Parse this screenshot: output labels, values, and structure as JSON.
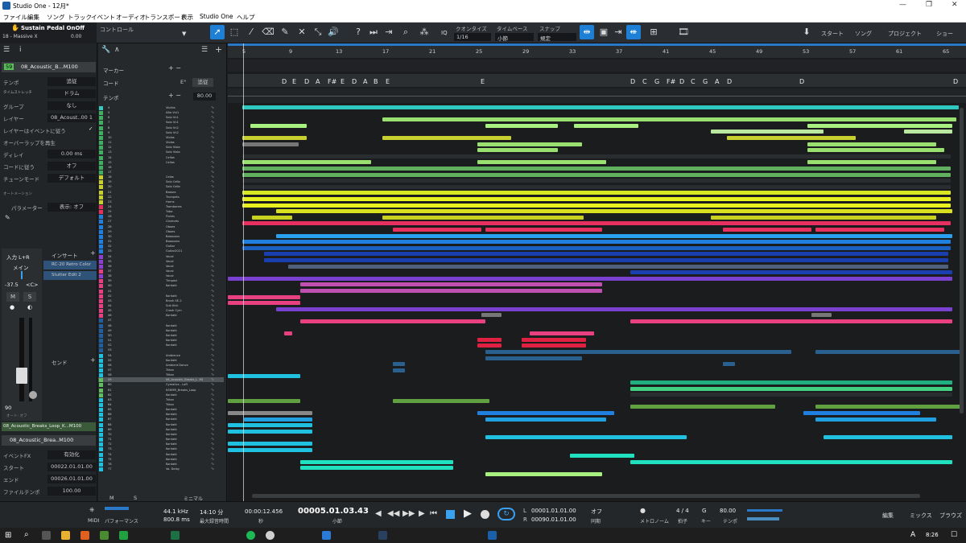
{
  "window": {
    "title": "Studio One - 12月*"
  },
  "menu": [
    "ファイル",
    "編集",
    "ソング",
    "トラック",
    "イベント",
    "オーディオ",
    "トランスポート",
    "表示",
    "Studio One",
    "ヘルプ"
  ],
  "toolbar": {
    "preset_name": "Sustain Pedal OnOff",
    "preset_sub": "18 - Massive X",
    "preset_value": "0.00",
    "control_label": "コントロール",
    "quantize_label": "クオンタイズ",
    "quantize_value": "1/16",
    "timebase_label": "タイムベース",
    "timebase_value": "小節",
    "snap_label": "スナップ",
    "snap_value": "規定",
    "iq": "IQ",
    "start": "スタート",
    "song": "ソング",
    "project": "プロジェクト",
    "show": "ショー"
  },
  "inspector": {
    "track_num": "59",
    "track_name": "08_Acoustic_B...M100",
    "rows": [
      {
        "k": "テンポ",
        "v": "追従"
      },
      {
        "k": "タイムストレッチ",
        "v": "ドラム"
      },
      {
        "k": "グループ",
        "v": "なし"
      },
      {
        "k": "レイヤー",
        "v": "08_Acoust..00 1"
      },
      {
        "k": "レイヤーはイベントに従う",
        "v": "✓"
      },
      {
        "k": "オーバーラップを再生",
        "v": ""
      },
      {
        "k": "ディレイ",
        "v": "0.00 ms"
      },
      {
        "k": "コードに従う",
        "v": "オフ"
      },
      {
        "k": "チューンモード",
        "v": "デフォルト"
      }
    ],
    "automation_label": "オートメーション",
    "param_label": "パラメーター",
    "param_value": "表示: オフ",
    "channel": {
      "input": "入力 L+R",
      "main": "メイン",
      "vol": "-37.5",
      "pan": "<C>",
      "m": "M",
      "s": "S",
      "fader_val": "90",
      "auto": "オート: オフ"
    },
    "inserts_label": "インサート",
    "insert1": "RC-20 Retro Color",
    "insert2": "Stutter Edit 2",
    "sends_label": "センド",
    "clip_name": "08_Acoustic_Breaks_Loop_K...M100",
    "event_name": "08_Acoustic_Brea..M100",
    "event_fx_label": "イベントFX",
    "event_fx_value": "有効化",
    "start_label": "スタート",
    "start_value": "00022.01.01.00",
    "end_label": "エンド",
    "end_value": "00026.01.01.00",
    "file_tempo_label": "ファイルテンポ",
    "file_tempo_value": "100.00"
  },
  "lanes": {
    "marker": "マーカー",
    "chord": "コード",
    "tempo": "テンポ",
    "key": "E°",
    "follow": "追従",
    "tempo_value": "80.00"
  },
  "ruler": [
    "5",
    "9",
    "13",
    "17",
    "21",
    "25",
    "29",
    "33",
    "37",
    "41",
    "45",
    "49",
    "53",
    "57",
    "61",
    "65"
  ],
  "chords": [
    "D",
    "E",
    "D",
    "A",
    "F#",
    "E",
    "D",
    "A",
    "B",
    "E",
    "E",
    "D",
    "C",
    "G",
    "F#",
    "D",
    "C",
    "G",
    "A",
    "D",
    "D",
    "D"
  ],
  "tracks": [
    {
      "n": "4",
      "name": "Violins",
      "c": "#37c8c0"
    },
    {
      "n": "5",
      "name": "Alto Vni1",
      "c": "#40b060"
    },
    {
      "n": "6",
      "name": "Solo Vn1",
      "c": "#40b060"
    },
    {
      "n": "7",
      "name": "Solo Vn1",
      "c": "#40b060"
    },
    {
      "n": "8",
      "name": "Solo Vn2",
      "c": "#40b060"
    },
    {
      "n": "9",
      "name": "Solo Vn2",
      "c": "#40b060"
    },
    {
      "n": "10",
      "name": "Violas",
      "c": "#40b060"
    },
    {
      "n": "11",
      "name": "Violas",
      "c": "#40b060"
    },
    {
      "n": "12",
      "name": "Solo Viola",
      "c": "#40b060"
    },
    {
      "n": "13",
      "name": "Solo Viola",
      "c": "#40b060"
    },
    {
      "n": "14",
      "name": "Cellos",
      "c": "#40b060"
    },
    {
      "n": "15",
      "name": "Cellos",
      "c": "#40b060"
    },
    {
      "n": "16",
      "name": "",
      "c": "#40b060"
    },
    {
      "n": "17",
      "name": "",
      "c": "#40b060"
    },
    {
      "n": "18",
      "name": "Celos",
      "c": "#c8d030"
    },
    {
      "n": "19",
      "name": "Solo Cello",
      "c": "#c8d030"
    },
    {
      "n": "20",
      "name": "Solo Cello",
      "c": "#c8d030"
    },
    {
      "n": "21",
      "name": "Basses",
      "c": "#c8d030"
    },
    {
      "n": "22",
      "name": "Trumpets",
      "c": "#c8d030"
    },
    {
      "n": "23",
      "name": "Horns",
      "c": "#c8d030"
    },
    {
      "n": "24",
      "name": "Trombones",
      "c": "#e83060"
    },
    {
      "n": "25",
      "name": "Tuba",
      "c": "#e83060"
    },
    {
      "n": "26",
      "name": "Flutes",
      "c": "#2080e0"
    },
    {
      "n": "27",
      "name": "Clarinets",
      "c": "#2080e0"
    },
    {
      "n": "28",
      "name": "Oboes",
      "c": "#2080e0"
    },
    {
      "n": "29",
      "name": "Oboes",
      "c": "#2080e0"
    },
    {
      "n": "30",
      "name": "Bassoons",
      "c": "#2080e0"
    },
    {
      "n": "31",
      "name": "Bassoons",
      "c": "#2080e0"
    },
    {
      "n": "32",
      "name": "Guitar",
      "c": "#2080e0"
    },
    {
      "n": "33",
      "name": "Guitar2021",
      "c": "#2080e0"
    },
    {
      "n": "34",
      "name": "Vocal",
      "c": "#9040d0"
    },
    {
      "n": "35",
      "name": "Vocal",
      "c": "#9040d0"
    },
    {
      "n": "36",
      "name": "Vocal",
      "c": "#9040d0"
    },
    {
      "n": "37",
      "name": "Vocal",
      "c": "#e84080"
    },
    {
      "n": "38",
      "name": "Vocal",
      "c": "#9040d0"
    },
    {
      "n": "39",
      "name": "Timpani",
      "c": "#e84080"
    },
    {
      "n": "40",
      "name": "Kontakt",
      "c": "#e84080"
    },
    {
      "n": "41",
      "name": "",
      "c": "#e84080"
    },
    {
      "n": "42",
      "name": "Kontakt",
      "c": "#e84080"
    },
    {
      "n": "43",
      "name": "Brush SE-2",
      "c": "#e84080"
    },
    {
      "n": "44",
      "name": "Sub Kick",
      "c": "#e84080"
    },
    {
      "n": "45",
      "name": "Crash Cym",
      "c": "#e84080"
    },
    {
      "n": "46",
      "name": "Kontakt",
      "c": "#e84080"
    },
    {
      "n": "47",
      "name": "",
      "c": "#2060a0"
    },
    {
      "n": "48",
      "name": "Kontakt",
      "c": "#2060a0"
    },
    {
      "n": "49",
      "name": "Kontakt",
      "c": "#2060a0"
    },
    {
      "n": "50",
      "name": "Kontakt",
      "c": "#2060a0"
    },
    {
      "n": "51",
      "name": "Kontakt",
      "c": "#2060a0"
    },
    {
      "n": "52",
      "name": "Kontakt",
      "c": "#2060a0"
    },
    {
      "n": "53",
      "name": "",
      "c": "#2060a0"
    },
    {
      "n": "54",
      "name": "Ambiance",
      "c": "#20c0e0"
    },
    {
      "n": "55",
      "name": "Kontakt",
      "c": "#20c0e0"
    },
    {
      "n": "56",
      "name": "Ambient Dance",
      "c": "#20c0e0"
    },
    {
      "n": "57",
      "name": "Tritan",
      "c": "#20c0e0"
    },
    {
      "n": "58",
      "name": "Tritan",
      "c": "#20c0e0"
    },
    {
      "n": "59",
      "name": "08_Acoustic_Breaks_L..M100",
      "c": "#60c060"
    },
    {
      "n": "60",
      "name": "Cymatics - LoFi",
      "c": "#60c060"
    },
    {
      "n": "61",
      "name": "KSHMR_Breaks_Loop",
      "c": "#60c060"
    },
    {
      "n": "62",
      "name": "Kontakt",
      "c": "#60c060"
    },
    {
      "n": "63",
      "name": "Tritan",
      "c": "#20c0e0"
    },
    {
      "n": "64",
      "name": "Tritan",
      "c": "#20c0e0"
    },
    {
      "n": "65",
      "name": "Kontakt",
      "c": "#20c0e0"
    },
    {
      "n": "66",
      "name": "Kontakt",
      "c": "#20c0e0"
    },
    {
      "n": "67",
      "name": "Kontakt",
      "c": "#20c0e0"
    },
    {
      "n": "68",
      "name": "Kontakt",
      "c": "#20c0e0"
    },
    {
      "n": "69",
      "name": "Kontakt",
      "c": "#20c0e0"
    },
    {
      "n": "70",
      "name": "Kontakt",
      "c": "#20c0e0"
    },
    {
      "n": "71",
      "name": "Kontakt",
      "c": "#20c0e0"
    },
    {
      "n": "72",
      "name": "Kontakt",
      "c": "#20c0e0"
    },
    {
      "n": "73",
      "name": "Kontakt",
      "c": "#20c0e0"
    },
    {
      "n": "74",
      "name": "Kontakt",
      "c": "#20c0e0"
    },
    {
      "n": "75",
      "name": "Kontakt",
      "c": "#20c0e0"
    },
    {
      "n": "76",
      "name": "Kontakt",
      "c": "#20c0e0"
    },
    {
      "n": "77",
      "name": "Vo. Delay",
      "c": "#20c0e0"
    }
  ],
  "bottom_tabs": {
    "m": "M",
    "s": "S",
    "mini": "ミニマル"
  },
  "transport": {
    "midi": "MIDI",
    "perf": "パフォーマンス",
    "rate": "44.1 kHz",
    "lat": "800.8 ms",
    "rec_time": "14:10 分",
    "rec_label": "最大録音時間",
    "seconds": "00:00:12.456",
    "sec_label": "秒",
    "bars": "00005.01.03.43",
    "bars_label": "小節",
    "L": "L",
    "R": "R",
    "loop_start": "00001.01.01.00",
    "loop_end": "00090.01.01.00",
    "off": "オフ",
    "sync": "同期",
    "metro": "メトロノーム",
    "timesig": "4 / 4",
    "timesig_label": "拍子",
    "key": "G",
    "key_label": "キー",
    "tempo": "80.00",
    "tempo_label": "テンポ",
    "edit": "編集",
    "mix": "ミックス",
    "browse": "ブラウズ"
  },
  "taskbar": {
    "time": "8:26",
    "ime": "A"
  }
}
